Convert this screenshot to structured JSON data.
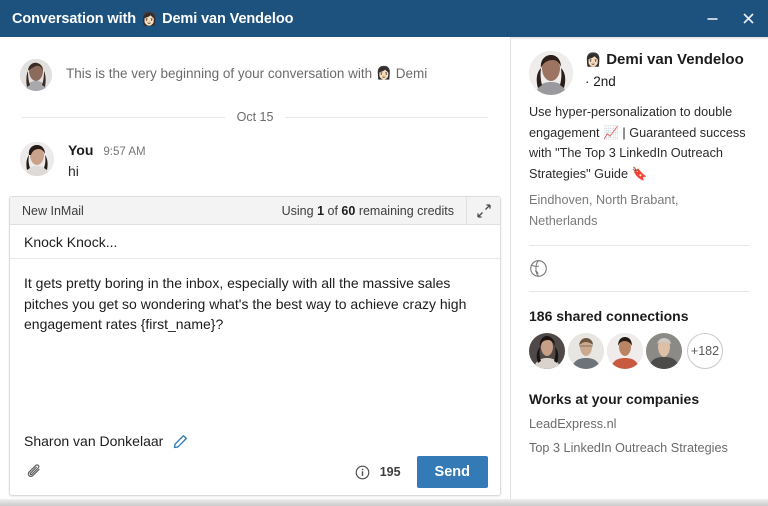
{
  "window": {
    "title_prefix": "Conversation with",
    "title_emoji": "👩🏻",
    "title_name": "Demi van Vendeloo",
    "minimize_label": "minimize",
    "close_label": "close"
  },
  "conversation": {
    "beginning_text": "This is the very beginning of your conversation with",
    "beginning_emoji": "👩🏻",
    "beginning_name": "Demi",
    "date_separator": "Oct 15",
    "messages": [
      {
        "author": "You",
        "time": "9:57 AM",
        "text": "hi"
      }
    ]
  },
  "composer": {
    "header_title": "New InMail",
    "credits_prefix": "Using",
    "credits_used": "1",
    "credits_mid": "of",
    "credits_total": "60",
    "credits_suffix": "remaining credits",
    "expand_icon": "expand-icon",
    "subject": "Knock Knock...",
    "body": "It gets pretty boring in the inbox, especially with all the massive sales pitches you get so wondering what's the best way to achieve crazy high engagement rates {first_name}?",
    "signature": "Sharon van Donkelaar",
    "edit_icon": "pencil-icon",
    "attach_icon": "paperclip-icon",
    "info_icon": "info-circle-icon",
    "char_count": "195",
    "send_label": "Send"
  },
  "profile": {
    "name": "Demi van Vendeloo",
    "name_emoji": "👩🏻",
    "degree": "· 2nd",
    "headline_part1": "Use hyper-personalization to double engagement",
    "headline_emoji1": "📈",
    "headline_part2": "| Guaranteed success with \"The Top 3 LinkedIn Outreach Strategies\" Guide",
    "headline_emoji2": "🔖",
    "location": "Eindhoven, North Brabant, Netherlands",
    "globe_icon": "globe-icon",
    "shared_connections_title": "186 shared connections",
    "shared_more": "+182",
    "works_title": "Works at your companies",
    "companies": [
      "LeadExpress.nl",
      "Top 3 LinkedIn Outreach Strategies"
    ]
  },
  "colors": {
    "titlebar": "#1d527e",
    "send_button": "#337ab7",
    "accent_link": "#2e7bb5"
  }
}
